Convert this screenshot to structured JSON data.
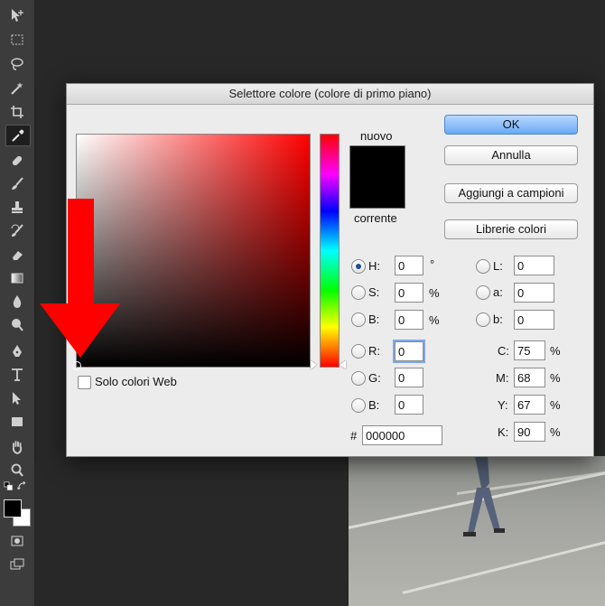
{
  "dialog": {
    "title": "Selettore colore (colore di primo piano)",
    "new_label": "nuovo",
    "current_label": "corrente",
    "new_color": "#000000",
    "web_only_label": "Solo colori Web",
    "buttons": {
      "ok": "OK",
      "cancel": "Annulla",
      "add_swatches": "Aggiungi a campioni",
      "color_libraries": "Librerie colori"
    },
    "hsb": [
      {
        "label": "H:",
        "value": "0",
        "unit": "°",
        "checked": true
      },
      {
        "label": "S:",
        "value": "0",
        "unit": "%",
        "checked": false
      },
      {
        "label": "B:",
        "value": "0",
        "unit": "%",
        "checked": false
      }
    ],
    "lab": [
      {
        "label": "L:",
        "value": "0"
      },
      {
        "label": "a:",
        "value": "0"
      },
      {
        "label": "b:",
        "value": "0"
      }
    ],
    "rgb": [
      {
        "label": "R:",
        "value": "0"
      },
      {
        "label": "G:",
        "value": "0"
      },
      {
        "label": "B:",
        "value": "0"
      }
    ],
    "cmyk": [
      {
        "label": "C:",
        "value": "75",
        "unit": "%"
      },
      {
        "label": "M:",
        "value": "68",
        "unit": "%"
      },
      {
        "label": "Y:",
        "value": "67",
        "unit": "%"
      },
      {
        "label": "K:",
        "value": "90",
        "unit": "%"
      }
    ],
    "hex_label": "#",
    "hex_value": "000000"
  },
  "colors": {
    "annotation_arrow": "#ff0000",
    "ok_button": "#6aaaf4"
  }
}
